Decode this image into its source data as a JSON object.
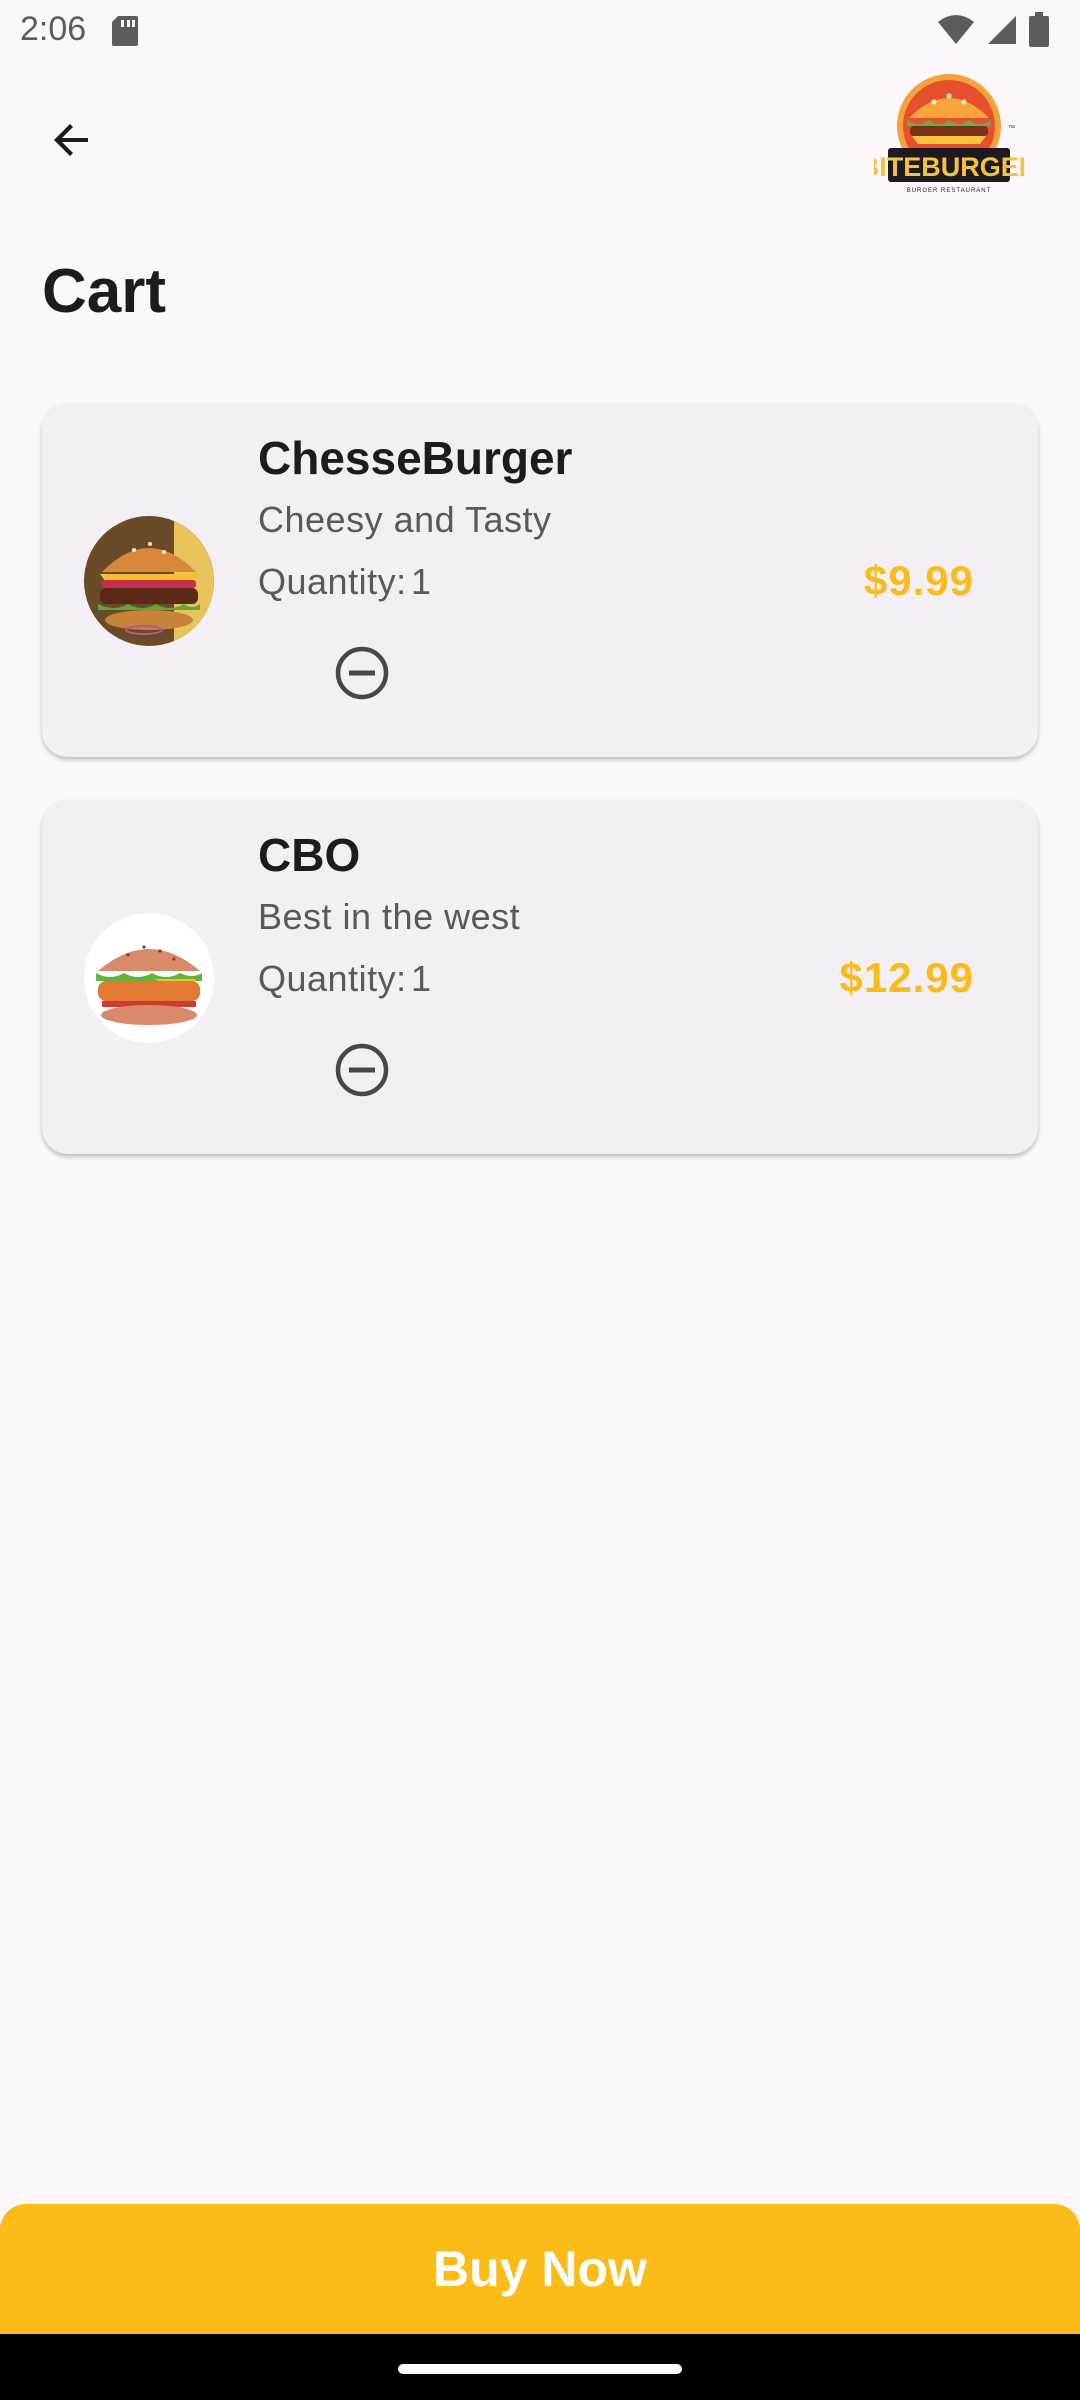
{
  "status_bar": {
    "time": "2:06"
  },
  "header": {
    "back_icon": "arrow-left-icon",
    "logo_text": "BITEBURGER",
    "logo_subtext": "BURGER RESTAURANT"
  },
  "page": {
    "title": "Cart"
  },
  "cart": {
    "items": [
      {
        "name": "ChesseBurger",
        "description": "Cheesy and Tasty",
        "quantity_label": "Quantity:",
        "quantity": "1",
        "price": "$9.99",
        "remove_icon": "remove-circle-icon"
      },
      {
        "name": "CBO",
        "description": "Best in the west",
        "quantity_label": "Quantity:",
        "quantity": "1",
        "price": "$12.99",
        "remove_icon": "remove-circle-icon"
      }
    ]
  },
  "footer": {
    "buy_label": "Buy Now"
  },
  "colors": {
    "accent": "#fbbc17",
    "background": "#fdf7fd",
    "card": "#f3eff5",
    "text": "#1d1b20"
  }
}
